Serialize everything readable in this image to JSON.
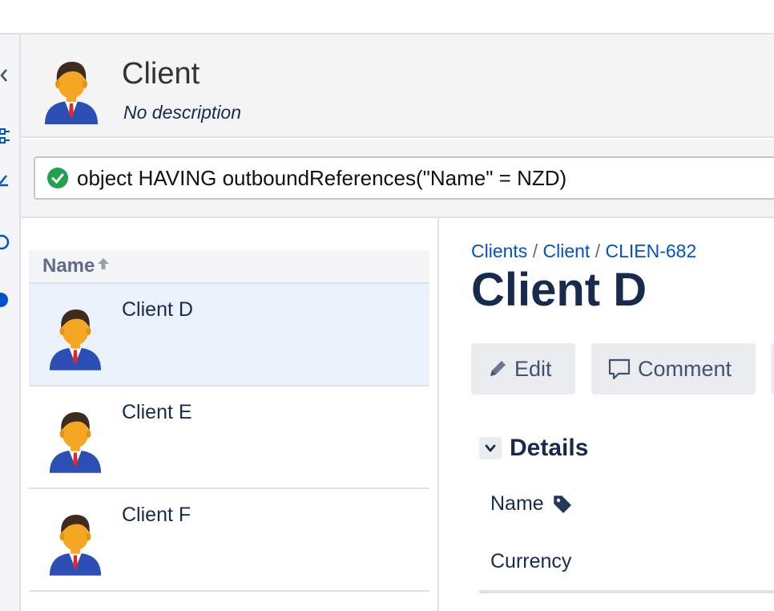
{
  "header": {
    "title": "Client",
    "description": "No description"
  },
  "query": {
    "status": "valid",
    "text": "object HAVING outboundReferences(\"Name\" = NZD)"
  },
  "list": {
    "column_header": "Name",
    "sort": "ascending",
    "rows": [
      {
        "label": "Client D",
        "selected": true
      },
      {
        "label": "Client E",
        "selected": false
      },
      {
        "label": "Client F",
        "selected": false
      }
    ]
  },
  "detail": {
    "breadcrumb": [
      "Clients",
      "Client",
      "CLIEN-682"
    ],
    "title": "Client D",
    "buttons": {
      "edit": "Edit",
      "comment": "Comment"
    },
    "section": "Details",
    "fields": {
      "name": "Name",
      "currency": "Currency"
    }
  },
  "colors": {
    "accent": "#0052cc",
    "selected_row": "#ebf1fa",
    "valid": "#36b37e"
  }
}
